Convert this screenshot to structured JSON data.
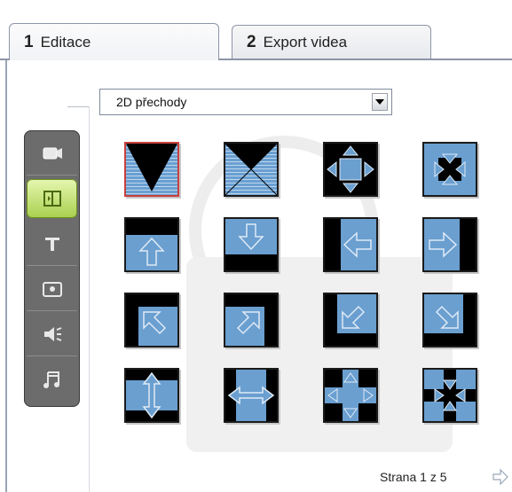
{
  "tabs": [
    {
      "number": "1",
      "label": "Editace",
      "active": true
    },
    {
      "number": "2",
      "label": "Export videa",
      "active": false
    }
  ],
  "dropdown": {
    "selected": "2D přechody"
  },
  "sidebar": {
    "items": [
      {
        "name": "video-icon",
        "active": false
      },
      {
        "name": "transitions-icon",
        "active": true
      },
      {
        "name": "title-icon",
        "active": false
      },
      {
        "name": "photo-icon",
        "active": false
      },
      {
        "name": "audio-icon",
        "active": false
      },
      {
        "name": "music-icon",
        "active": false
      }
    ]
  },
  "transitions": [
    "wipe-down-triangle",
    "hourglass",
    "expand-four-arrows",
    "collapse-four-arrows",
    "slide-up",
    "slide-down",
    "slide-left",
    "slide-right",
    "slide-up-left",
    "slide-up-right",
    "slide-down-left",
    "slide-down-right",
    "split-vertical",
    "split-horizontal",
    "cross-expand",
    "cross-collapse"
  ],
  "pager": {
    "text": "Strana 1 z 5"
  },
  "colors": {
    "accent_blue": "#6a9fd0",
    "active_green": "#a8cf4e",
    "sidebar_gray": "#6c6c6c"
  }
}
